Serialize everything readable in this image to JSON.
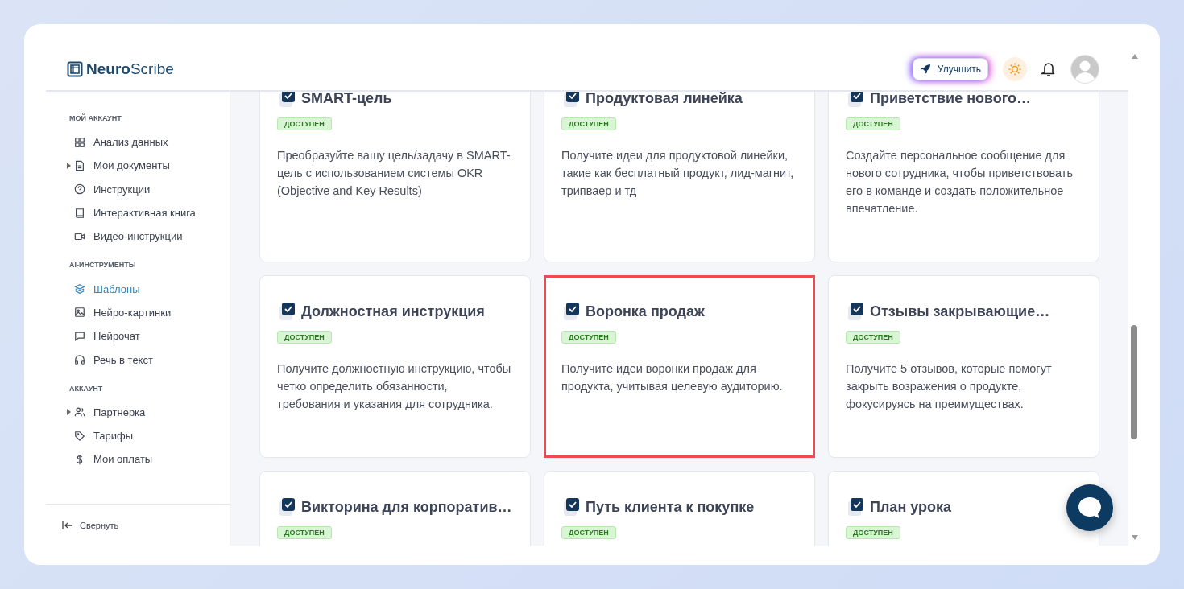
{
  "logo": {
    "brand_bold": "Neuro",
    "brand_rest": "Scribe"
  },
  "header": {
    "upgrade_button": "Улучшить"
  },
  "sidebar": {
    "sections": [
      {
        "title": "МОЙ АККАУНТ",
        "items": [
          {
            "label": "Анализ данных",
            "expandable": false,
            "selected": false
          },
          {
            "label": "Мои документы",
            "expandable": true,
            "selected": false
          },
          {
            "label": "Инструкции",
            "expandable": false,
            "selected": false
          },
          {
            "label": "Интерактивная книга",
            "expandable": false,
            "selected": false
          },
          {
            "label": "Видео-инструкции",
            "expandable": false,
            "selected": false
          }
        ]
      },
      {
        "title": "AI-ИНСТРУМЕНТЫ",
        "items": [
          {
            "label": "Шаблоны",
            "expandable": false,
            "selected": true
          },
          {
            "label": "Нейро-картинки",
            "expandable": false,
            "selected": false
          },
          {
            "label": "Нейрочат",
            "expandable": false,
            "selected": false
          },
          {
            "label": "Речь в текст",
            "expandable": false,
            "selected": false
          }
        ]
      },
      {
        "title": "АККАУНТ",
        "items": [
          {
            "label": "Партнерка",
            "expandable": true,
            "selected": false
          },
          {
            "label": "Тарифы",
            "expandable": false,
            "selected": false
          },
          {
            "label": "Мои оплаты",
            "expandable": false,
            "selected": false
          }
        ]
      }
    ],
    "collapse": "Свернуть"
  },
  "cards": [
    {
      "title": "SMART-цель",
      "badge": "ДОСТУПЕН",
      "description": "Преобразуйте вашу цель/задачу в SMART-цель с использованием системы OKR (Objective and Key Results)",
      "selected": false
    },
    {
      "title": "Продуктовая линейка",
      "badge": "ДОСТУПЕН",
      "description": "Получите идеи для продуктовой линейки, такие как бесплатный продукт, лид-магнит, трипваер и тд",
      "selected": false
    },
    {
      "title": "Приветствие нового…",
      "badge": "ДОСТУПЕН",
      "description": "Создайте персональное сообщение для нового сотрудника, чтобы приветствовать его в команде и создать положительное впечатление.",
      "selected": false
    },
    {
      "title": "Должностная инструкция",
      "badge": "ДОСТУПЕН",
      "description": "Получите должностную инструкцию, чтобы четко определить обязанности, требования и указания для сотрудника.",
      "selected": false
    },
    {
      "title": "Воронка продаж",
      "badge": "ДОСТУПЕН",
      "description": "Получите идеи воронки продаж для продукта, учитывая целевую аудиторию.",
      "selected": true
    },
    {
      "title": "Отзывы закрывающие…",
      "badge": "ДОСТУПЕН",
      "description": "Получите 5 отзывов, которые помогут закрыть возражения о продукте, фокусируясь на преимуществах.",
      "selected": false
    },
    {
      "title": "Викторина для корпоратив…",
      "badge": "ДОСТУПЕН",
      "selected": false
    },
    {
      "title": "Путь клиента к покупке",
      "badge": "ДОСТУПЕН",
      "selected": false
    },
    {
      "title": "План урока",
      "badge": "ДОСТУПЕН",
      "selected": false
    }
  ]
}
